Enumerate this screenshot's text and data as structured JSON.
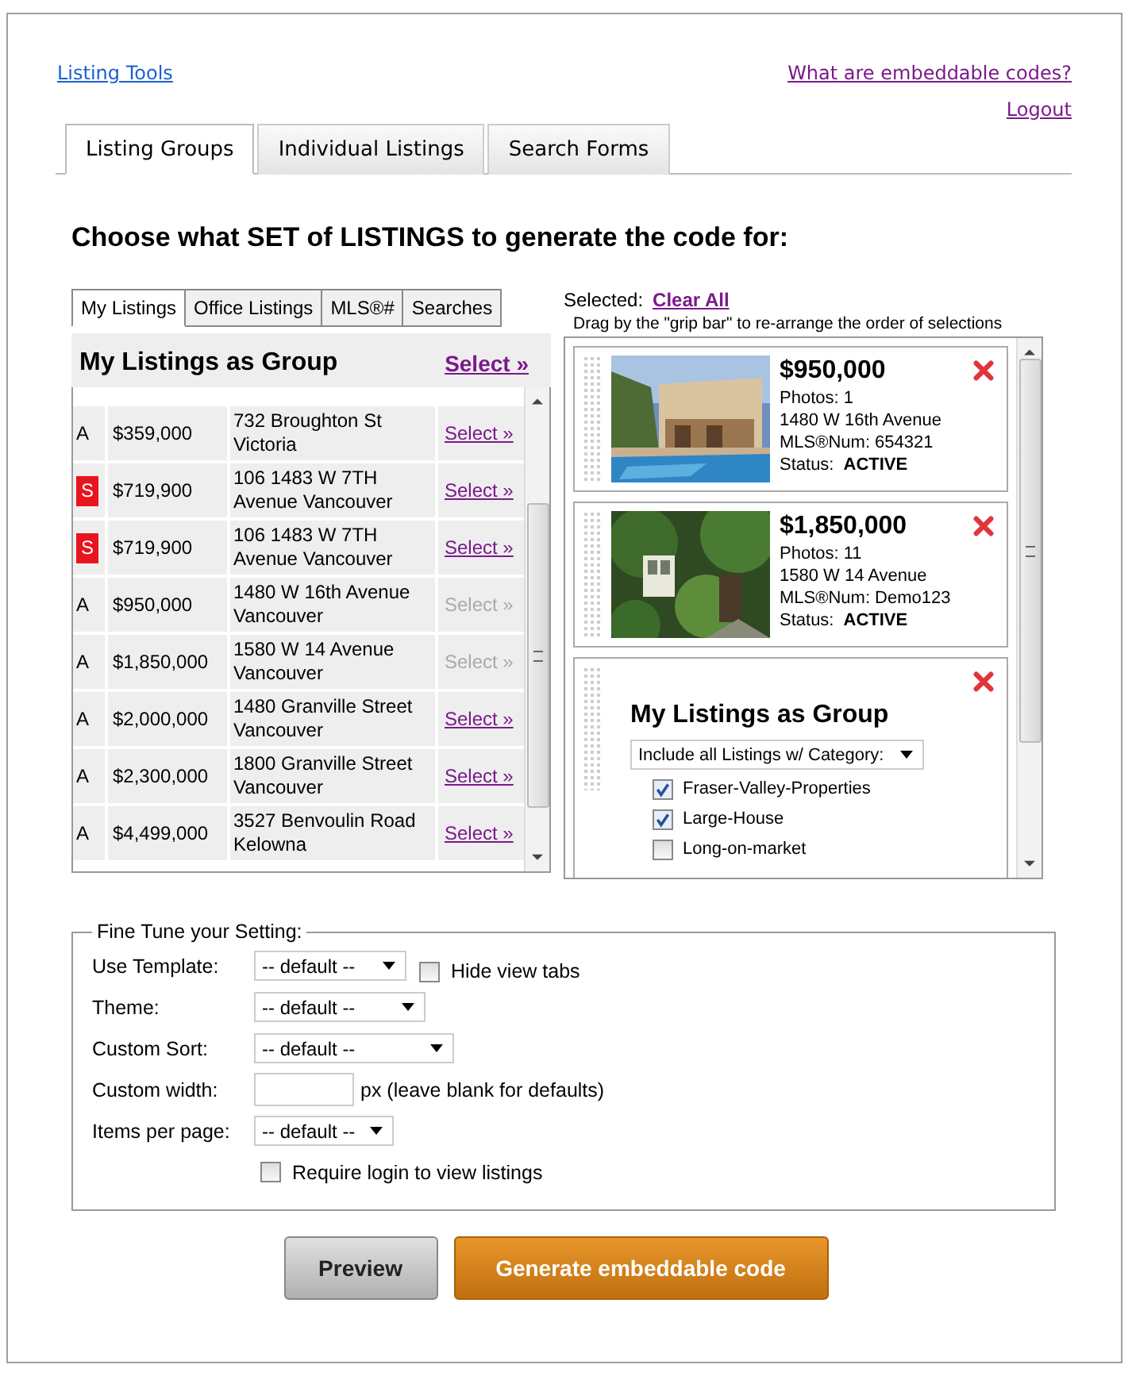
{
  "header": {
    "tools_link": "Listing Tools",
    "help_link": "What are embeddable codes?",
    "logout_link": "Logout"
  },
  "tabs": [
    {
      "label": "Listing Groups",
      "selected": true
    },
    {
      "label": "Individual Listings",
      "selected": false
    },
    {
      "label": "Search Forms",
      "selected": false
    }
  ],
  "heading": "Choose what **SET** of **LISTINGS** to generate the code for:",
  "source_tabs": [
    {
      "label": "My Listings",
      "selected": true
    },
    {
      "label": "Office Listings",
      "selected": false
    },
    {
      "label": "MLS®#",
      "selected": false
    },
    {
      "label": "Searches",
      "selected": false
    }
  ],
  "group_panel": {
    "title": "My Listings as Group",
    "select_link": "Select »"
  },
  "listings": [
    {
      "status": "A",
      "price": "$359,000",
      "address": "732 Broughton St Victoria",
      "select": "Select »",
      "disabled": false
    },
    {
      "status": "S",
      "price": "$719,900",
      "address": "106 1483 W 7TH Avenue Vancouver",
      "select": "Select »",
      "disabled": false
    },
    {
      "status": "S",
      "price": "$719,900",
      "address": "106 1483 W 7TH Avenue Vancouver",
      "select": "Select »",
      "disabled": false
    },
    {
      "status": "A",
      "price": "$950,000",
      "address": "1480 W 16th Avenue Vancouver",
      "select": "Select »",
      "disabled": true
    },
    {
      "status": "A",
      "price": "$1,850,000",
      "address": "1580 W 14 Avenue Vancouver",
      "select": "Select »",
      "disabled": true
    },
    {
      "status": "A",
      "price": "$2,000,000",
      "address": "1480 Granville Street Vancouver",
      "select": "Select »",
      "disabled": false
    },
    {
      "status": "A",
      "price": "$2,300,000",
      "address": "1800 Granville Street Vancouver",
      "select": "Select »",
      "disabled": false
    },
    {
      "status": "A",
      "price": "$4,499,000",
      "address": "3527 Benvoulin Road Kelowna",
      "select": "Select »",
      "disabled": false
    }
  ],
  "selected_panel": {
    "label": "Selected:",
    "clear_link": "Clear All",
    "hint": "Drag by the \"grip bar\" to re-arrange the order of selections",
    "items": [
      {
        "kind": "listing",
        "price": "$950,000",
        "photos": "Photos: 1",
        "address": "1480 W 16th Avenue",
        "mls": "MLS®Num: 654321",
        "status_label": "Status:",
        "status": "ACTIVE"
      },
      {
        "kind": "listing",
        "price": "$1,850,000",
        "photos": "Photos: 11",
        "address": "1580 W 14 Avenue",
        "mls": "MLS®Num: Demo123",
        "status_label": "Status:",
        "status": "ACTIVE"
      },
      {
        "kind": "group",
        "title": "My Listings as Group",
        "filter": "Include all Listings w/ Category:",
        "categories": [
          {
            "label": "Fraser-Valley-Properties",
            "checked": true
          },
          {
            "label": "Large-House",
            "checked": true
          },
          {
            "label": "Long-on-market",
            "checked": false
          }
        ]
      }
    ]
  },
  "settings": {
    "legend": "Fine Tune your Setting:",
    "template": {
      "label": "Use Template:",
      "value": "-- default --"
    },
    "hide_tabs": {
      "label": "Hide view tabs",
      "checked": false
    },
    "theme": {
      "label": "Theme:",
      "value": "-- default --"
    },
    "sort": {
      "label": "Custom Sort:",
      "value": "-- default --"
    },
    "width": {
      "label": "Custom width:",
      "suffix": "px (leave blank for defaults)"
    },
    "per_page": {
      "label": "Items per page:",
      "value": "-- default --"
    },
    "require_login": {
      "label": "Require login to view listings",
      "checked": false
    }
  },
  "buttons": {
    "preview": "Preview",
    "generate": "Generate embeddable code"
  }
}
